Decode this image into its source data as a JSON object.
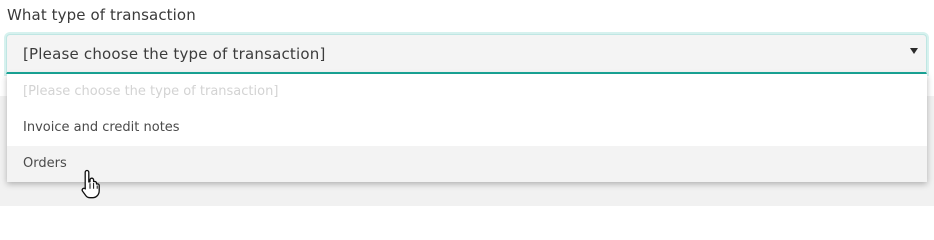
{
  "form": {
    "label": "What type of transaction",
    "select": {
      "selected_text": "[Please choose the type of transaction]"
    }
  },
  "dropdown": {
    "options": [
      {
        "label": "[Please choose the type of transaction]",
        "disabled": true
      },
      {
        "label": "Invoice and credit notes"
      },
      {
        "label": "Orders",
        "hovered": true
      }
    ]
  },
  "colors": {
    "accent": "#1aa89a",
    "focus_ring": "#d6f1ee",
    "hover_bg": "#f3f3f3"
  },
  "icons": {
    "caret": "triangle-down-icon",
    "cursor": "hand-pointer-icon"
  }
}
